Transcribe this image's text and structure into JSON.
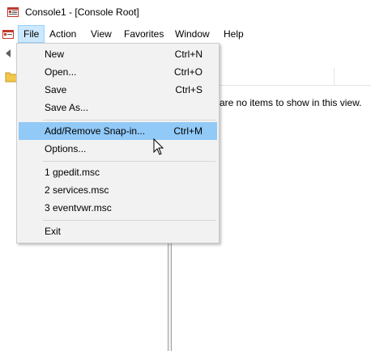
{
  "window": {
    "title": "Console1 - [Console Root]",
    "app_icon": "mmc-app-icon"
  },
  "menubar": {
    "items": [
      {
        "label": "File",
        "active": true
      },
      {
        "label": "Action"
      },
      {
        "label": "View"
      },
      {
        "label": "Favorites"
      },
      {
        "label": "Window"
      },
      {
        "label": "Help"
      }
    ]
  },
  "file_menu": {
    "items": [
      {
        "label": "New",
        "shortcut": "Ctrl+N"
      },
      {
        "label": "Open...",
        "shortcut": "Ctrl+O"
      },
      {
        "label": "Save",
        "shortcut": "Ctrl+S"
      },
      {
        "label": "Save As...",
        "shortcut": ""
      },
      {
        "label": "Add/Remove Snap-in...",
        "shortcut": "Ctrl+M",
        "highlighted": true
      },
      {
        "label": "Options...",
        "shortcut": ""
      },
      {
        "label": "1 gpedit.msc",
        "shortcut": ""
      },
      {
        "label": "2 services.msc",
        "shortcut": ""
      },
      {
        "label": "3 eventvwr.msc",
        "shortcut": ""
      },
      {
        "label": "Exit",
        "shortcut": ""
      }
    ]
  },
  "right_pane": {
    "empty_message": "are no items to show in this view."
  },
  "colors": {
    "menu_highlight": "#91c9f7",
    "menubar_active": "#cce8ff",
    "menu_background": "#f2f2f2"
  }
}
